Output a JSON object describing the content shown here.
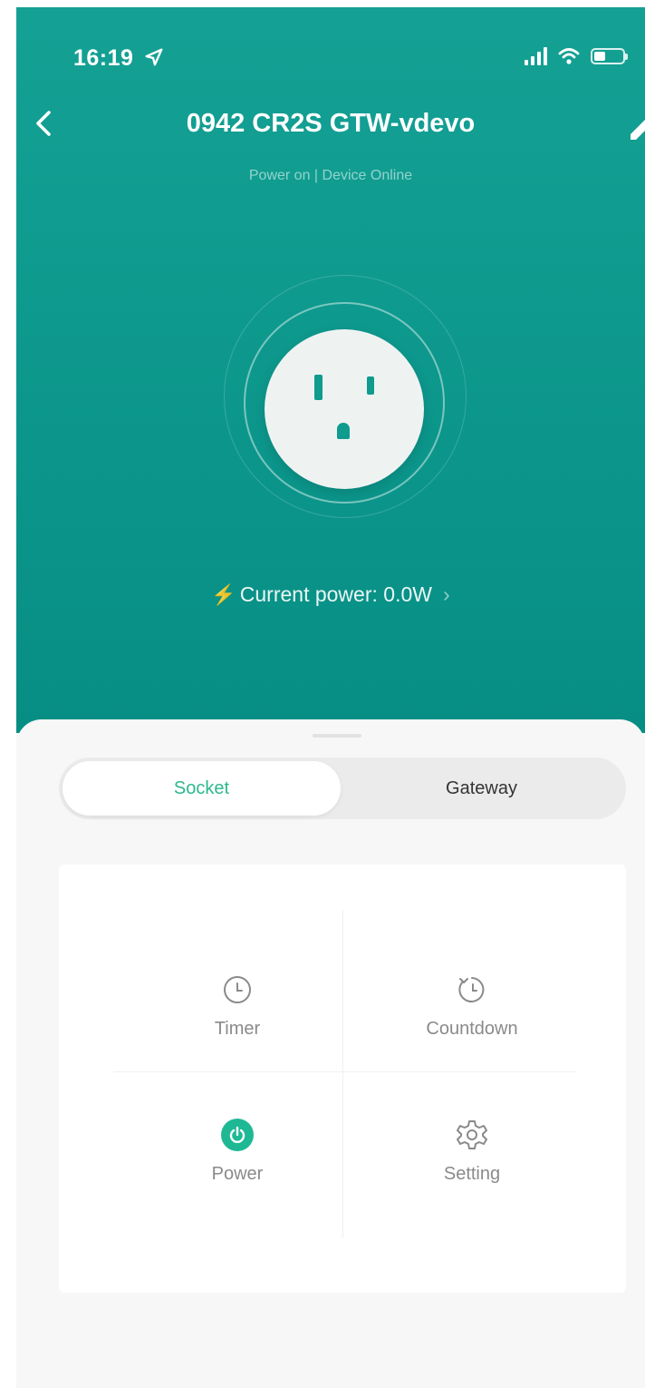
{
  "status_bar": {
    "time": "16:19"
  },
  "header": {
    "title": "0942 CR2S GTW-vdevo",
    "subtitle": "Power on | Device Online"
  },
  "power": {
    "label": "Current power: 0.0W"
  },
  "tabs": [
    {
      "label": "Socket",
      "selected": true
    },
    {
      "label": "Gateway",
      "selected": false
    }
  ],
  "functions": {
    "timer": "Timer",
    "countdown": "Countdown",
    "power": "Power",
    "setting": "Setting"
  },
  "colors": {
    "header_bg": "#0f9b8e",
    "accent": "#1fb894",
    "tab_active_text": "#2db88f"
  },
  "icons": {
    "back": "chevron-left-icon",
    "edit": "edit-icon",
    "location": "location-arrow-icon",
    "signal": "signal-icon",
    "wifi": "wifi-icon",
    "battery": "battery-icon",
    "bolt": "lightning-icon",
    "chevron": "chevron-right-icon",
    "timer": "clock-icon",
    "countdown": "countdown-icon",
    "power": "power-icon",
    "setting": "gear-icon"
  }
}
